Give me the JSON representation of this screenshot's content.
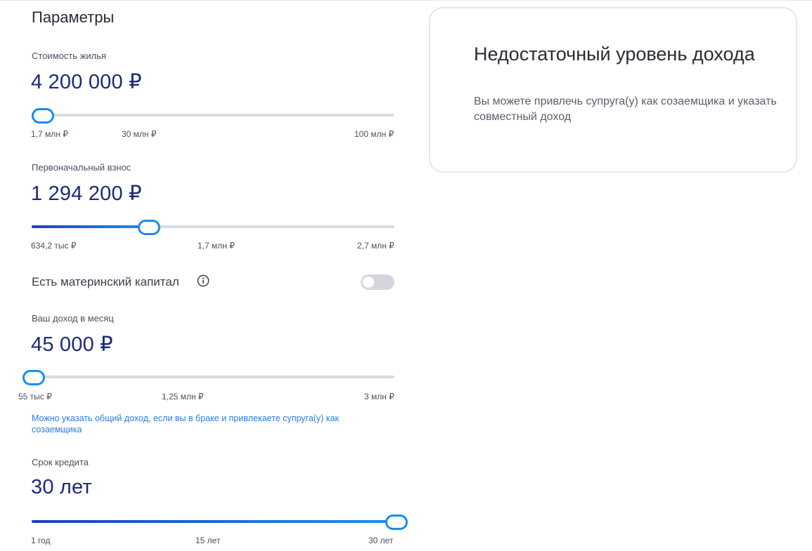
{
  "section_title": "Параметры",
  "price": {
    "label": "Стоимость жилья",
    "value": "4 200 000 ₽",
    "slider_fraction": 0.025,
    "ticks": [
      "1,7 млн ₽",
      "30 млн ₽",
      "100 млн ₽"
    ]
  },
  "down_payment": {
    "label": "Первоначальный взнос",
    "value": "1 294 200 ₽",
    "slider_fraction": 0.317,
    "ticks": [
      "634,2 тыс ₽",
      "1,7 млн ₽",
      "2,7 млн ₽"
    ]
  },
  "maternity_capital": {
    "label": "Есть материнский капитал",
    "info_icon": "info-icon",
    "enabled": false
  },
  "income": {
    "label": "Ваш доход в месяц",
    "value": "45 000 ₽",
    "slider_fraction": 0.0,
    "ticks": [
      "55 тыс ₽",
      "1,25 млн ₽",
      "3 млн ₽"
    ],
    "hint": "Можно указать общий доход, если вы в браке и привлекаете супруга(у) как созаемщика"
  },
  "term": {
    "label": "Срок кредита",
    "value": "30 лет",
    "slider_fraction": 1.0,
    "ticks": [
      "1 год",
      "15 лет",
      "30 лет"
    ]
  },
  "result_card": {
    "title": "Недостаточный уровень дохода",
    "text": "Вы можете привлечь супруга(у) как созаемщика и указать совместный доход"
  },
  "colors": {
    "accent": "#1a8cf0",
    "value_text": "#1d2a78",
    "hint_text": "#2a7be4",
    "track": "#d9dbe1"
  }
}
